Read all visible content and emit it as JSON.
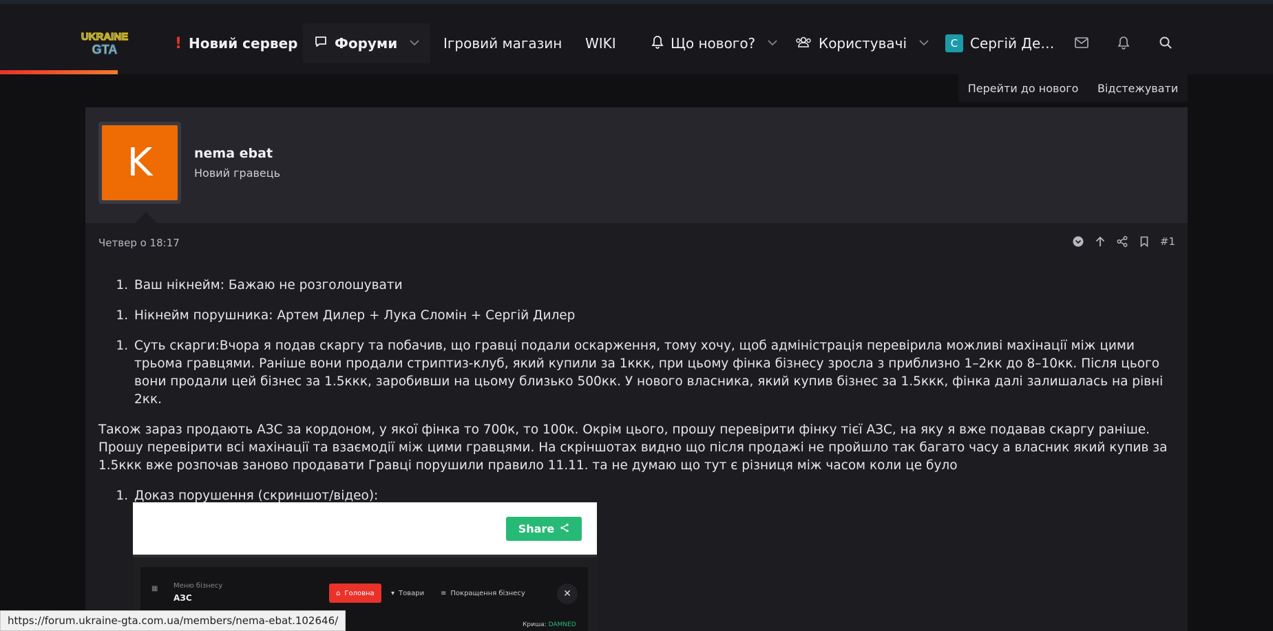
{
  "nav": {
    "logo_text": [
      "UKRAINE",
      "GTA"
    ],
    "new_server": "Новий сервер",
    "forums": "Форуми",
    "shop": "Ігровий магазин",
    "wiki": "WIKI",
    "whats_new": "Що нового?",
    "users": "Користувачі",
    "user_initial": "С",
    "user_name": "Сергій Де…",
    "accent_color": "#e8322a"
  },
  "thread_actions": {
    "goto_new": "Перейти до нового",
    "watch": "Відстежувати"
  },
  "post": {
    "avatar_letter": "K",
    "avatar_color": "#ee6c03",
    "username": "nema ebat",
    "user_title": "Новий гравець",
    "date": "Четвер о 18:17",
    "number": "#1",
    "items": {
      "nickname": "Ваш нікнейм: Бажаю не розголошувати",
      "violator": "Нікнейм порушника: Артем Дилер + Лука Сломін + Сергій Дилер",
      "essence": "Суть скарги:Вчора я подав скаргу та побачив, що гравці подали оскарження, тому хочу, щоб адміністрація перевірила можливі махінації між цими трьома гравцями. Раніше вони продали стриптиз-клуб, який купили за 1ккк, при цьому фінка бізнесу зросла з приблизно 1–2кк до 8–10кк. Після цього вони продали цей бізнес за 1.5ккк, заробивши на цьому близько 500кк. У нового власника, який купив бізнес за 1.5ккк, фінка далі залишалась на рівні 2кк.",
      "evidence": "Доказ порушення (скриншот/відео):"
    },
    "paragraph": "Також зараз продають АЗС за кордоном, у якої фінка то 700к, то 100к. Окрім цього, прошу перевірити фінку тієї АЗС, на яку я вже подавав скаргу раніше. Прошу перевірити всі махінації та взаємодії між цими гравцями. На скріншотах видно що після продажі не пройшло так багато часу а власник який купив за 1.5ккк вже розпочав заново продавати Гравці порушили правило 11.11. та не думаю що тут є різниця між часом коли це було"
  },
  "screenshot": {
    "share": "Share",
    "menu_label": "Меню бізнесу",
    "menu_title": "АЗС",
    "tab_main": "Головна",
    "tab_goods": "Товари",
    "tab_upgrade": "Покращення бізнесу",
    "roof_label": "Криша:",
    "roof_value": "DAMNED",
    "share_color": "#27ba76"
  },
  "status_url": "https://forum.ukraine-gta.com.ua/members/nema-ebat.102646/"
}
